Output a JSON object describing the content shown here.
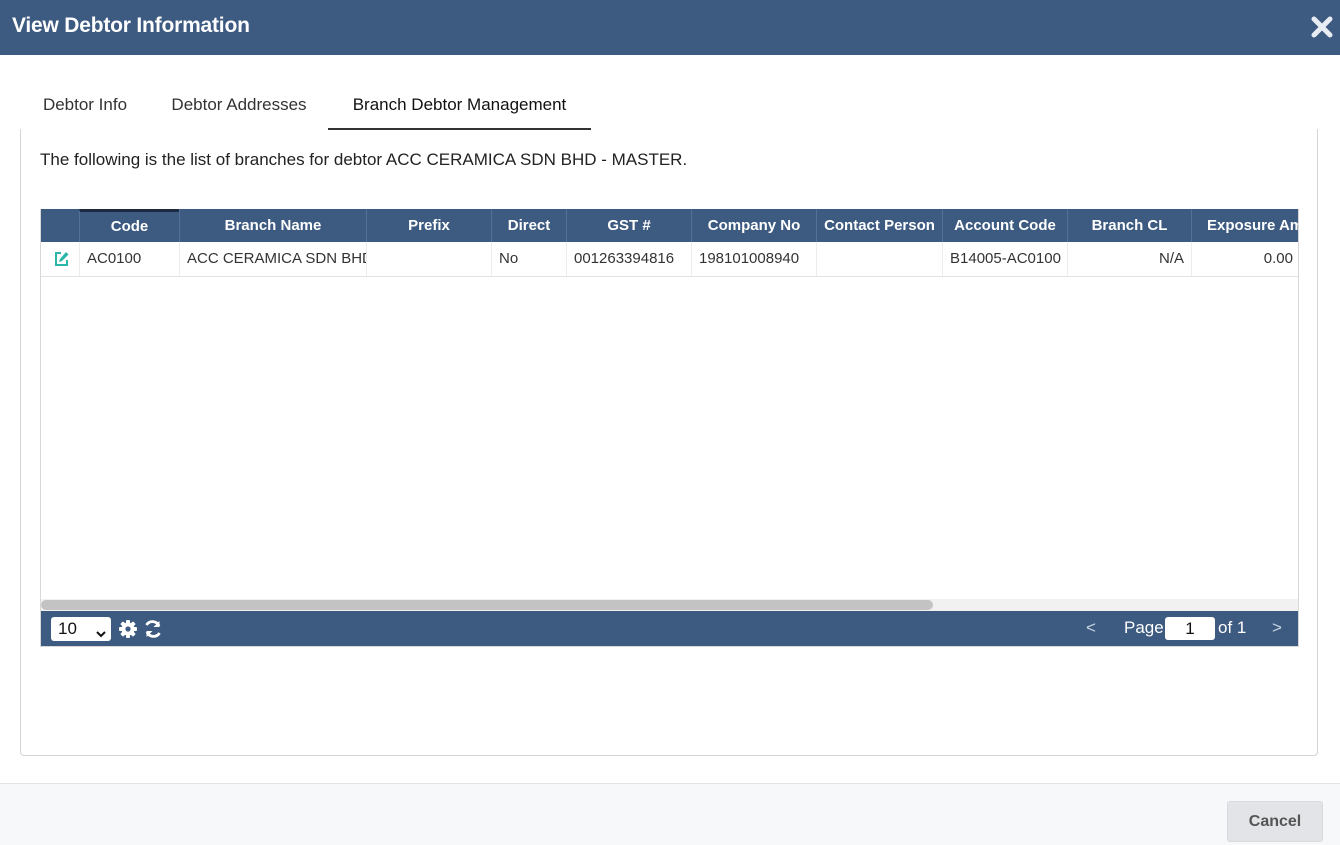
{
  "modal": {
    "title": "View Debtor Information"
  },
  "tabs": [
    {
      "label": "Debtor Info",
      "active": false
    },
    {
      "label": "Debtor Addresses",
      "active": false
    },
    {
      "label": "Branch Debtor Management",
      "active": true
    }
  ],
  "panel": {
    "description": "The following is the list of branches for debtor ACC CERAMICA SDN BHD - MASTER."
  },
  "grid": {
    "columns": [
      "Code",
      "Branch Name",
      "Prefix",
      "Direct",
      "GST #",
      "Company No",
      "Contact Person",
      "Account Code",
      "Branch CL",
      "Exposure Amt"
    ],
    "sorted_column": "Code",
    "rows": [
      {
        "code": "AC0100",
        "branch_name": "ACC CERAMICA SDN BHD",
        "prefix": "",
        "direct": "No",
        "gst": "001263394816",
        "company_no": "198101008940",
        "contact_person": "",
        "account_code": "B14005-AC0100",
        "branch_cl": "N/A",
        "exposure_amt": "0.00"
      }
    ],
    "row_action_icon": "edit-icon"
  },
  "pager": {
    "page_size": "10",
    "page_label": "Page",
    "current_page": "1",
    "of_label": "of 1",
    "prev": "<",
    "next": ">"
  },
  "footer": {
    "cancel_label": "Cancel"
  },
  "colors": {
    "header_bg": "#3d5a80",
    "edit_icon": "#2ab7a9",
    "cancel_bg": "#e2e4e7"
  }
}
